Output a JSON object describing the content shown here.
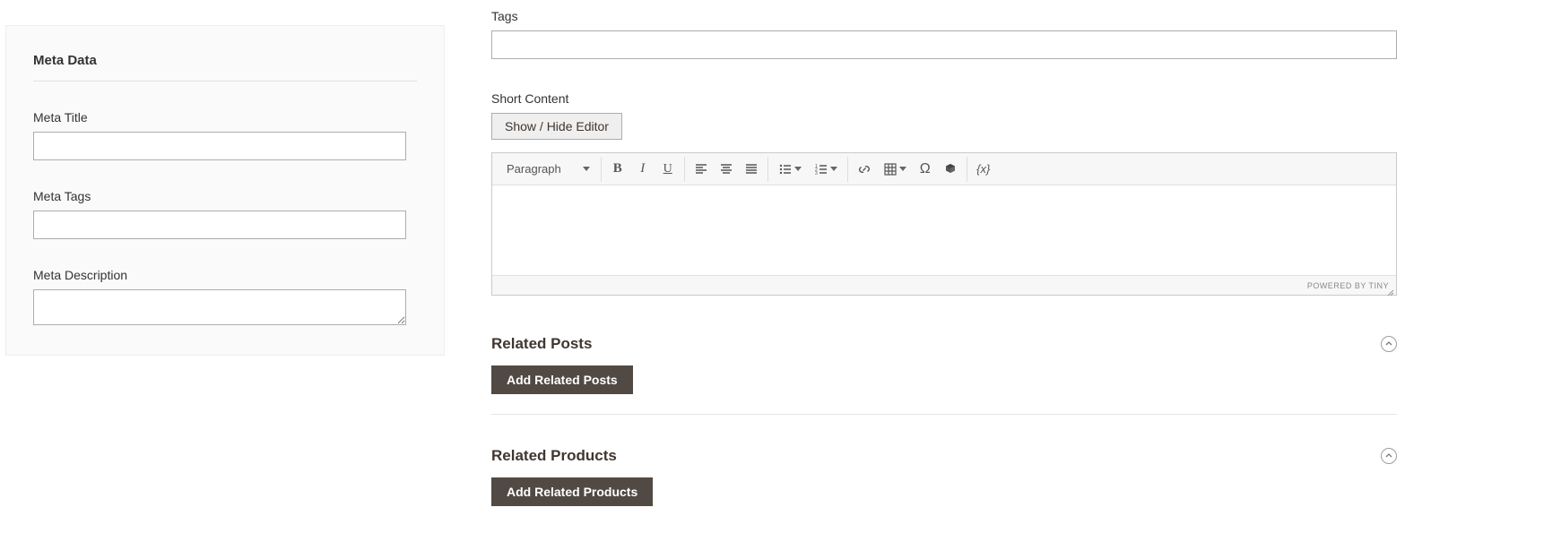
{
  "meta": {
    "panel_title": "Meta Data",
    "title_label": "Meta Title",
    "title_value": "",
    "tags_label": "Meta Tags",
    "tags_value": "",
    "desc_label": "Meta Description",
    "desc_value": ""
  },
  "tags": {
    "label": "Tags",
    "value": ""
  },
  "short_content": {
    "label": "Short Content",
    "toggle_button": "Show / Hide Editor",
    "paragraph_label": "Paragraph",
    "powered_by": "POWERED BY TINY"
  },
  "related_posts": {
    "title": "Related Posts",
    "button": "Add Related Posts"
  },
  "related_products": {
    "title": "Related Products",
    "button": "Add Related Products"
  },
  "icons": {
    "bold": "bold-icon",
    "italic": "italic-icon",
    "underline": "underline-icon",
    "align_left": "align-left-icon",
    "align_center": "align-center-icon",
    "align_justify": "align-justify-icon",
    "bullet_list": "bullet-list-icon",
    "number_list": "number-list-icon",
    "link": "link-icon",
    "table": "table-icon",
    "special_char": "omega-icon",
    "cube": "cube-icon",
    "variable": "variable-icon"
  }
}
